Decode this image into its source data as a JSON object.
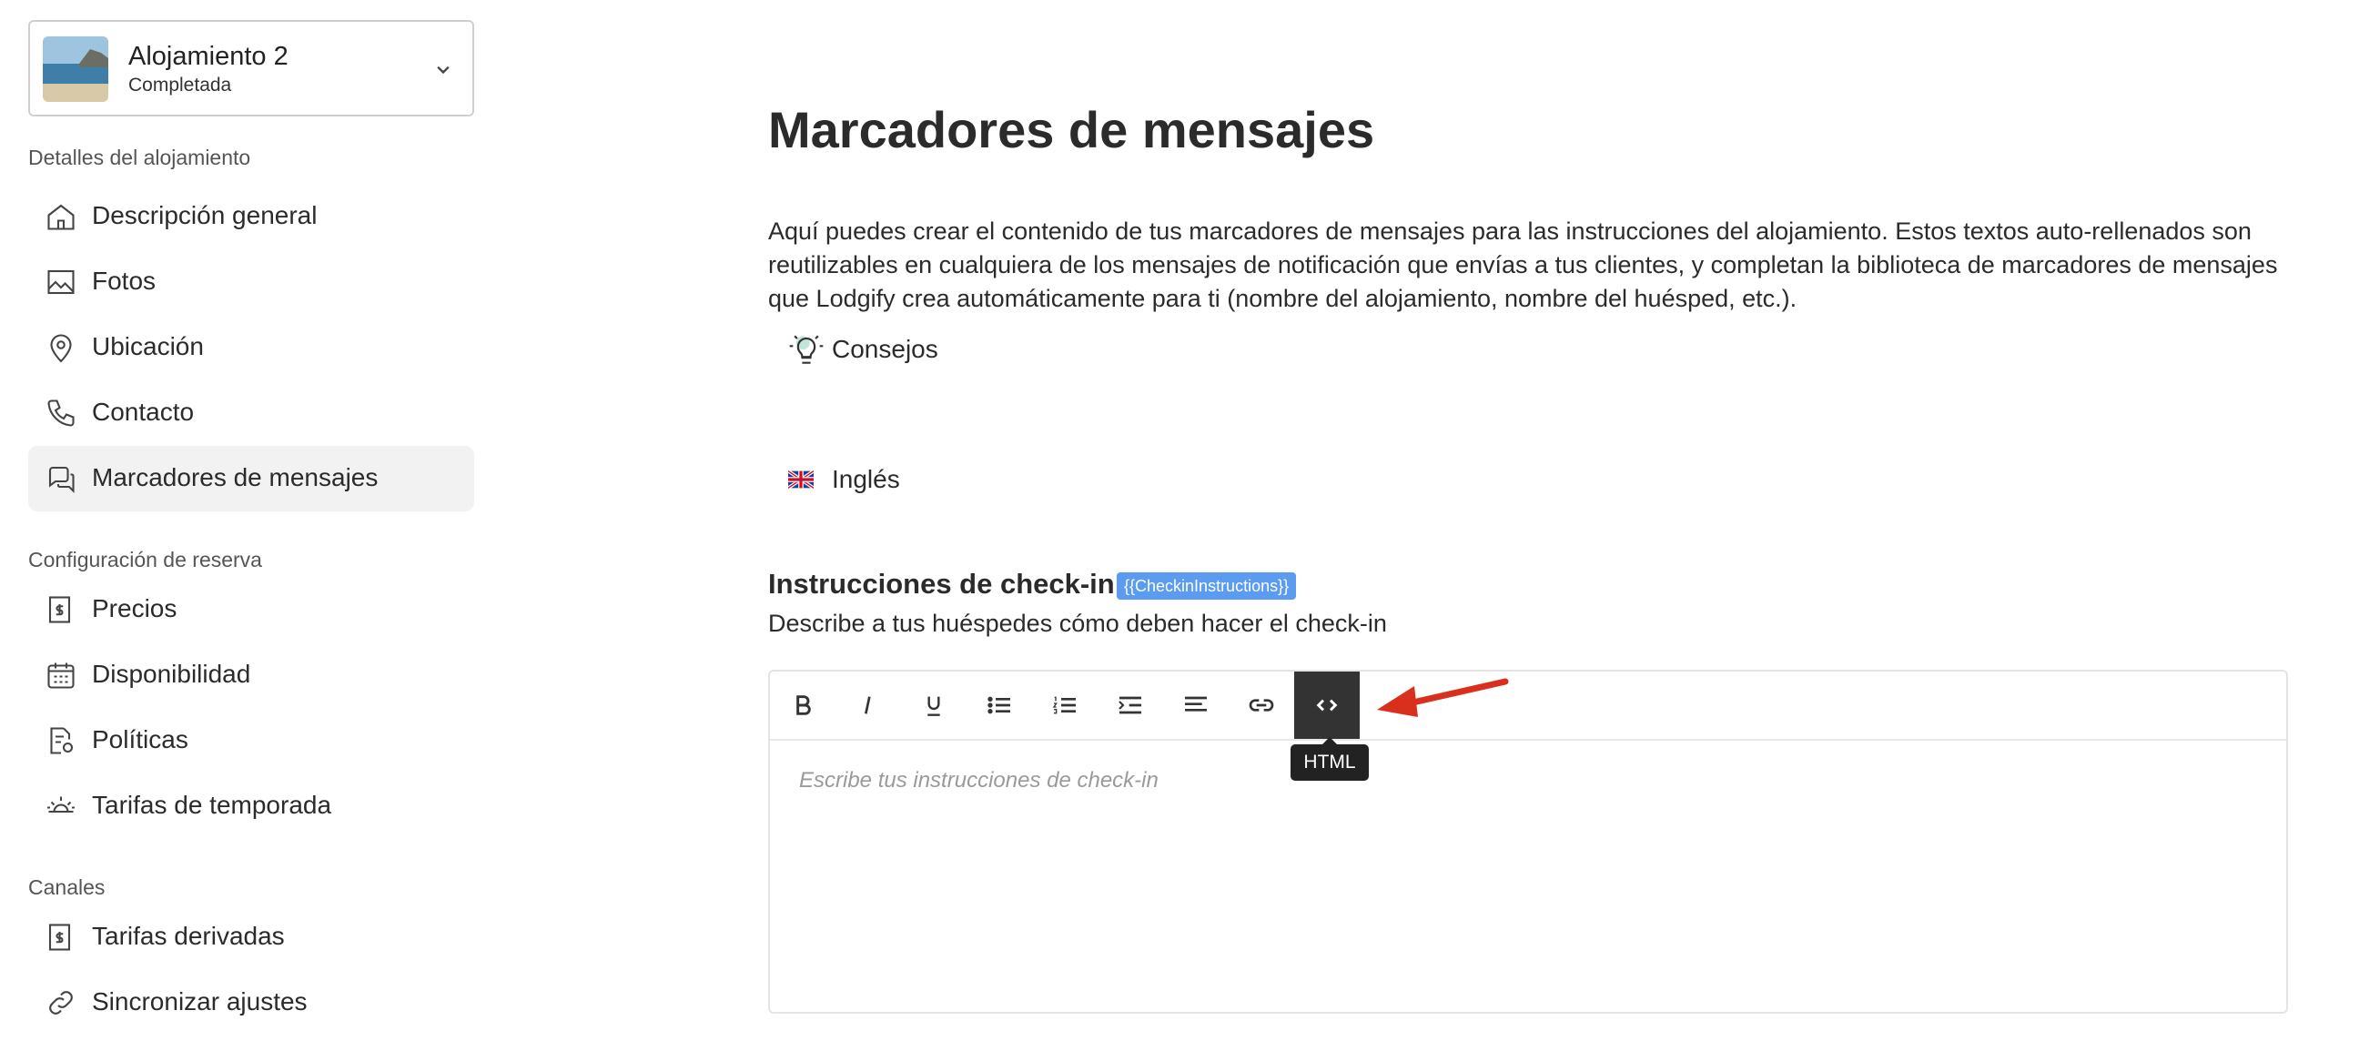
{
  "property": {
    "name": "Alojamiento 2",
    "status": "Completada"
  },
  "sidebar": {
    "sections": [
      {
        "title": "Detalles del alojamiento",
        "items": [
          {
            "label": "Descripción general",
            "icon": "home-icon"
          },
          {
            "label": "Fotos",
            "icon": "image-icon"
          },
          {
            "label": "Ubicación",
            "icon": "location-pin-icon"
          },
          {
            "label": "Contacto",
            "icon": "phone-icon"
          },
          {
            "label": "Marcadores de mensajes",
            "icon": "chat-bubbles-icon",
            "active": true
          }
        ]
      },
      {
        "title": "Configuración de reserva",
        "items": [
          {
            "label": "Precios",
            "icon": "price-tag-icon"
          },
          {
            "label": "Disponibilidad",
            "icon": "calendar-icon"
          },
          {
            "label": "Políticas",
            "icon": "policy-document-icon"
          },
          {
            "label": "Tarifas de temporada",
            "icon": "sun-icon"
          }
        ]
      },
      {
        "title": "Canales",
        "items": [
          {
            "label": "Tarifas derivadas",
            "icon": "price-tag-icon"
          },
          {
            "label": "Sincronizar ajustes",
            "icon": "link-icon"
          }
        ]
      }
    ]
  },
  "main": {
    "title": "Marcadores de mensajes",
    "intro": "Aquí puedes crear el contenido de tus marcadores de mensajes para las instrucciones del alojamiento. Estos textos auto-rellenados son reutilizables en cualquiera de los mensajes de notificación que envías a tus clientes, y completan la biblioteca de marcadores de mensajes que Lodgify crea automáticamente para ti (nombre del alojamiento, nombre del huésped, etc.).",
    "tips_label": "Consejos",
    "language_label": "Inglés",
    "field": {
      "title": "Instrucciones de check-in",
      "placeholder_tag": "{{CheckinInstructions}}",
      "description": "Describe a tus huéspedes cómo deben hacer el check-in",
      "editor_placeholder": "Escribe tus instrucciones de check-in"
    },
    "toolbar": {
      "buttons": [
        "bold",
        "italic",
        "underline",
        "bullet-list",
        "numbered-list",
        "indent",
        "align",
        "link",
        "html"
      ],
      "active": "html",
      "tooltip": "HTML"
    }
  },
  "colors": {
    "accent_tag": "#5b9bf0",
    "active_button": "#333333",
    "annotation_arrow": "#d9301d"
  }
}
